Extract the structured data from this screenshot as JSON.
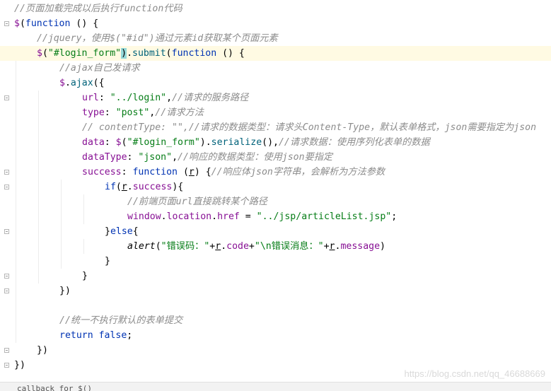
{
  "lines": [
    {
      "tokens": [
        [
          "c",
          "//页面加载完成以后执行function代码"
        ]
      ]
    },
    {
      "tokens": [
        [
          "p",
          "$"
        ],
        [
          "d",
          "("
        ],
        [
          "k",
          "function"
        ],
        [
          "d",
          " () {"
        ]
      ]
    },
    {
      "tokens": [
        [
          "c",
          "//jquery，使用$(\"#id\")通过元素id获取某个页面元素"
        ]
      ]
    },
    {
      "tokens": [
        [
          "p",
          "$"
        ],
        [
          "d",
          "("
        ],
        [
          "s",
          "\"#login_form\""
        ],
        [
          "hl",
          ")"
        ],
        [
          "d",
          "."
        ],
        [
          "m",
          "submit"
        ],
        [
          "d",
          "("
        ],
        [
          "k",
          "function"
        ],
        [
          "d",
          " () {"
        ]
      ]
    },
    {
      "tokens": [
        [
          "c",
          "//ajax自己发请求"
        ]
      ]
    },
    {
      "tokens": [
        [
          "p",
          "$"
        ],
        [
          "d",
          "."
        ],
        [
          "m",
          "ajax"
        ],
        [
          "d",
          "({"
        ]
      ]
    },
    {
      "tokens": [
        [
          "p",
          "url"
        ],
        [
          "d",
          ": "
        ],
        [
          "s",
          "\"../login\""
        ],
        [
          "d",
          ","
        ],
        [
          "c",
          "//请求的服务路径"
        ]
      ]
    },
    {
      "tokens": [
        [
          "p",
          "type"
        ],
        [
          "d",
          ": "
        ],
        [
          "s",
          "\"post\""
        ],
        [
          "d",
          ","
        ],
        [
          "c",
          "//请求方法"
        ]
      ]
    },
    {
      "tokens": [
        [
          "c",
          "// contentType: \"\",//请求的数据类型：请求头Content-Type，默认表单格式，json需要指定为json"
        ]
      ]
    },
    {
      "tokens": [
        [
          "p",
          "data"
        ],
        [
          "d",
          ": "
        ],
        [
          "p",
          "$"
        ],
        [
          "d",
          "("
        ],
        [
          "s",
          "\"#login_form\""
        ],
        [
          "d",
          ")."
        ],
        [
          "m",
          "serialize"
        ],
        [
          "d",
          "(),"
        ],
        [
          "c",
          "//请求数据：使用序列化表单的数据"
        ]
      ]
    },
    {
      "tokens": [
        [
          "p",
          "dataType"
        ],
        [
          "d",
          ": "
        ],
        [
          "s",
          "\"json\""
        ],
        [
          "d",
          ","
        ],
        [
          "c",
          "//响应的数据类型：使用json要指定"
        ]
      ]
    },
    {
      "tokens": [
        [
          "p",
          "success"
        ],
        [
          "d",
          ": "
        ],
        [
          "k",
          "function"
        ],
        [
          "d",
          " ("
        ],
        [
          "u",
          "r"
        ],
        [
          "d",
          ") {"
        ],
        [
          "c",
          "//响应体json字符串，会解析为方法参数"
        ]
      ]
    },
    {
      "tokens": [
        [
          "k",
          "if"
        ],
        [
          "d",
          "("
        ],
        [
          "u",
          "r"
        ],
        [
          "d",
          "."
        ],
        [
          "p",
          "success"
        ],
        [
          "d",
          "){"
        ]
      ]
    },
    {
      "tokens": [
        [
          "c",
          "//前端页面url直接跳转某个路径"
        ]
      ]
    },
    {
      "tokens": [
        [
          "p",
          "window"
        ],
        [
          "d",
          "."
        ],
        [
          "p",
          "location"
        ],
        [
          "d",
          "."
        ],
        [
          "p",
          "href"
        ],
        [
          "d",
          " = "
        ],
        [
          "s",
          "\"../jsp/articleList.jsp\""
        ],
        [
          "d",
          ";"
        ]
      ]
    },
    {
      "tokens": [
        [
          "d",
          "}"
        ],
        [
          "k",
          "else"
        ],
        [
          "d",
          "{"
        ]
      ]
    },
    {
      "tokens": [
        [
          "fnI",
          "alert"
        ],
        [
          "d",
          "("
        ],
        [
          "s",
          "\"错误码：\""
        ],
        [
          "d",
          "+"
        ],
        [
          "u",
          "r"
        ],
        [
          "d",
          "."
        ],
        [
          "p",
          "code"
        ],
        [
          "d",
          "+"
        ],
        [
          "s",
          "\"\\n错误消息：\""
        ],
        [
          "d",
          "+"
        ],
        [
          "u",
          "r"
        ],
        [
          "d",
          "."
        ],
        [
          "p",
          "message"
        ],
        [
          "d",
          ")"
        ]
      ]
    },
    {
      "tokens": [
        [
          "d",
          "}"
        ]
      ]
    },
    {
      "tokens": [
        [
          "d",
          "}"
        ]
      ]
    },
    {
      "tokens": [
        [
          "d",
          "})"
        ]
      ]
    },
    {
      "tokens": []
    },
    {
      "tokens": [
        [
          "c",
          "//统一不执行默认的表单提交"
        ]
      ]
    },
    {
      "tokens": [
        [
          "k",
          "return"
        ],
        [
          "d",
          " "
        ],
        [
          "k",
          "false"
        ],
        [
          "d",
          ";"
        ]
      ]
    },
    {
      "tokens": [
        [
          "d",
          "})"
        ]
      ]
    },
    {
      "tokens": [
        [
          "d",
          "})"
        ]
      ]
    }
  ],
  "watermark": "https://blog.csdn.net/qq_46688669",
  "status_fragment": "callback for $()"
}
